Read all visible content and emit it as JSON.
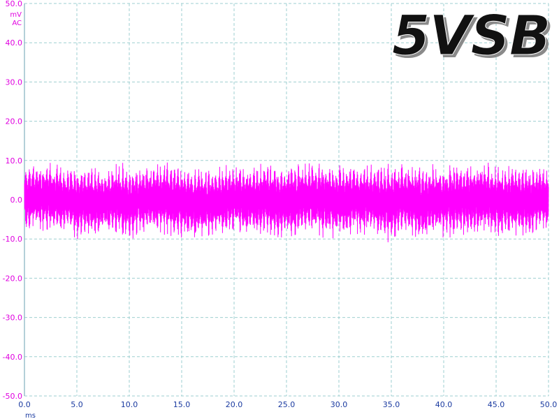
{
  "chart_data": {
    "type": "line",
    "title": "5VSB",
    "xlabel": "ms",
    "ylabel": "",
    "y_unit": "mV",
    "y_coupling": "AC",
    "xlim": [
      0,
      50
    ],
    "ylim": [
      -50,
      50
    ],
    "x_ticks": [
      "0.0",
      "5.0",
      "10.0",
      "15.0",
      "20.0",
      "25.0",
      "30.0",
      "35.0",
      "40.0",
      "45.0",
      "50.0"
    ],
    "y_ticks": [
      "50.0",
      "40.0",
      "30.0",
      "20.0",
      "10.0",
      "0.0",
      "-10.0",
      "-20.0",
      "-30.0",
      "-40.0",
      "-50.0"
    ],
    "grid": true,
    "series": [
      {
        "color": "#ff00ff",
        "x": [
          0,
          1,
          2,
          3,
          4,
          5,
          6,
          7,
          8,
          9,
          10,
          11,
          12,
          13,
          14,
          15,
          16,
          17,
          18,
          19,
          20,
          21,
          22,
          23,
          24,
          25,
          26,
          27,
          28,
          29,
          30,
          31,
          32,
          33,
          34,
          35,
          36,
          37,
          38,
          39,
          40,
          41,
          42,
          43,
          44,
          45,
          46,
          47,
          48,
          49,
          50
        ],
        "y_max": [
          9.5,
          9.8,
          10.2,
          9.4,
          8.6,
          9.0,
          8.8,
          8.2,
          8.5,
          9.9,
          8.7,
          8.8,
          9.3,
          10.1,
          9.6,
          9.0,
          8.8,
          8.7,
          7.9,
          9.3,
          9.2,
          9.0,
          9.3,
          10.0,
          9.2,
          9.3,
          9.5,
          9.6,
          9.7,
          9.6,
          9.5,
          9.5,
          9.6,
          9.5,
          9.6,
          9.6,
          9.5,
          9.6,
          9.5,
          9.6,
          9.3,
          9.6,
          9.6,
          9.9,
          9.4,
          9.6,
          9.0,
          9.5,
          8.9,
          9.2,
          9.0
        ],
        "y_min": [
          -8.2,
          -8.4,
          -8.7,
          -9.0,
          -8.5,
          -10.5,
          -9.8,
          -9.6,
          -9.2,
          -9.6,
          -11.2,
          -9.0,
          -8.8,
          -9.5,
          -9.6,
          -10.2,
          -10.6,
          -10.4,
          -9.7,
          -9.6,
          -8.8,
          -9.8,
          -10.1,
          -9.3,
          -10.6,
          -9.9,
          -9.6,
          -8.4,
          -9.5,
          -9.8,
          -10.2,
          -9.4,
          -9.6,
          -9.5,
          -10.3,
          -11.6,
          -9.0,
          -9.8,
          -12.1,
          -9.6,
          -10.1,
          -9.4,
          -9.7,
          -9.3,
          -9.2,
          -10.0,
          -10.4,
          -9.6,
          -9.6,
          -9.1,
          -8.6
        ]
      }
    ]
  }
}
